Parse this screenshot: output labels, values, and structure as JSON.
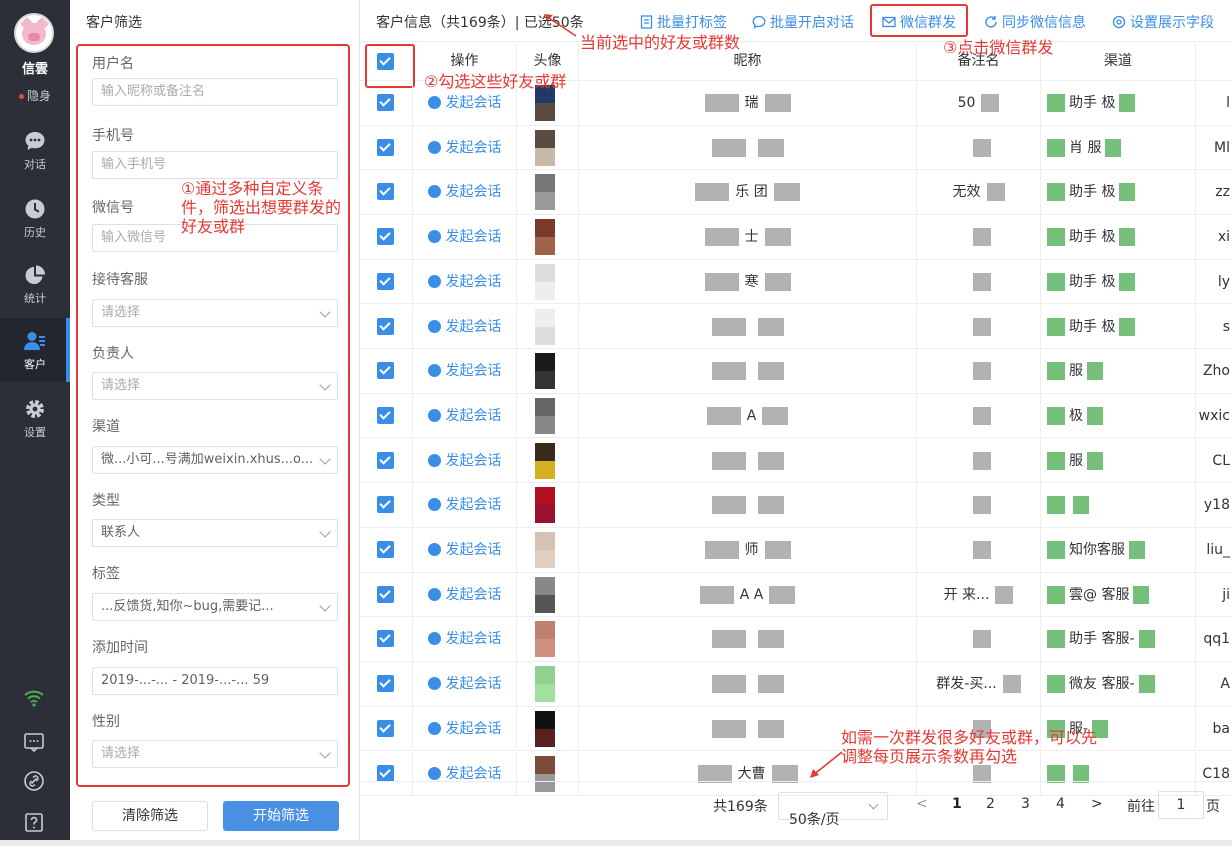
{
  "app": {
    "brand": "信雲",
    "status": "隐身"
  },
  "nav": [
    {
      "label": "对话",
      "icon": "chat-icon"
    },
    {
      "label": "历史",
      "icon": "clock-icon"
    },
    {
      "label": "统计",
      "icon": "pie-chart-icon"
    },
    {
      "label": "客户",
      "icon": "customer-icon"
    },
    {
      "label": "设置",
      "icon": "gear-icon"
    }
  ],
  "filter": {
    "title": "客户筛选",
    "fields": [
      {
        "label": "用户名",
        "value": "",
        "placeholder": "输入昵称或备注名",
        "type": "input"
      },
      {
        "label": "手机号",
        "value": "",
        "placeholder": "输入手机号",
        "type": "input"
      },
      {
        "label": "微信号",
        "value": "",
        "placeholder": "输入微信号",
        "type": "input"
      },
      {
        "label": "接待客服",
        "value": "",
        "placeholder": "请选择",
        "type": "select"
      },
      {
        "label": "负责人",
        "value": "",
        "placeholder": "请选择",
        "type": "select"
      },
      {
        "label": "渠道",
        "value": "微...小可...号满加weixin.xhus...o...",
        "placeholder": "",
        "type": "select"
      },
      {
        "label": "类型",
        "value": "联系人",
        "placeholder": "",
        "type": "select"
      },
      {
        "label": "标签",
        "value": "...反馈货,知你~bug,需要记...",
        "placeholder": "",
        "type": "select"
      },
      {
        "label": "添加时间",
        "value": "2019-...-... - 2019-...-... 59",
        "placeholder": "",
        "type": "input"
      },
      {
        "label": "性别",
        "value": "",
        "placeholder": "请选择",
        "type": "select"
      }
    ],
    "clear_label": "清除筛选",
    "start_label": "开始筛选"
  },
  "main": {
    "title": "客户信息（共169条）| 已选50条",
    "actions": [
      {
        "label": "批量打标签",
        "icon": "tag-icon"
      },
      {
        "label": "批量开启对话",
        "icon": "chat-icon"
      },
      {
        "label": "微信群发",
        "icon": "mail-icon"
      },
      {
        "label": "同步微信信息",
        "icon": "refresh-icon"
      },
      {
        "label": "设置展示字段",
        "icon": "settings-icon"
      }
    ],
    "columns": [
      "操作",
      "头像",
      "昵称",
      "备注名",
      "渠道"
    ],
    "action_label": "发起会话",
    "rows": [
      {
        "nick": "瑞",
        "remark": "50",
        "channel": "助手 极",
        "last": "l"
      },
      {
        "nick": "",
        "remark": "",
        "channel": "肖 服",
        "last": "Ml"
      },
      {
        "nick": "乐 团",
        "remark": "无效",
        "channel": "助手 极",
        "last": "zz"
      },
      {
        "nick": "士",
        "remark": "",
        "channel": "助手 极",
        "last": "xi"
      },
      {
        "nick": "寒",
        "remark": "",
        "channel": "助手 极",
        "last": "ly"
      },
      {
        "nick": "",
        "remark": "",
        "channel": "助手 极",
        "last": "s"
      },
      {
        "nick": "",
        "remark": "",
        "channel": "服",
        "last": "Zho"
      },
      {
        "nick": "A",
        "remark": "",
        "channel": "极",
        "last": "wxic"
      },
      {
        "nick": "",
        "remark": "",
        "channel": "服",
        "last": "CL"
      },
      {
        "nick": "",
        "remark": "",
        "channel": "",
        "last": "y18"
      },
      {
        "nick": "师",
        "remark": "",
        "channel": "知你客服",
        "last": "liu_"
      },
      {
        "nick": "A A",
        "remark": "开 来...",
        "channel": "雲@ 客服",
        "last": "ji"
      },
      {
        "nick": "",
        "remark": "",
        "channel": "助手 客服-",
        "last": "qq1"
      },
      {
        "nick": "",
        "remark": "群发-买...",
        "channel": "微友 客服-",
        "last": "A"
      },
      {
        "nick": "",
        "remark": "",
        "channel": "服-",
        "last": "ba"
      },
      {
        "nick": "大曹",
        "remark": "",
        "channel": "",
        "last": "C18"
      }
    ],
    "pager": {
      "total": "共169条",
      "page_size": "50条/页",
      "pages": [
        "1",
        "2",
        "3",
        "4"
      ],
      "goto_label": "前往",
      "goto_value": "1",
      "page_suffix": "页"
    }
  },
  "annotations": {
    "a1": "①通过多种自定义条件，筛选出想要群发的好友或群",
    "a2": "②勾选这些好友或群",
    "a3": "③点击微信群发",
    "a4": "当前选中的好友或群数",
    "a5": "如需一次群发很多好友或群，可以先调整每页展示条数再勾选"
  },
  "colors": {
    "accent": "#3a8ee6",
    "annotation": "#e53935",
    "nav_bg": "#2c2f38"
  }
}
